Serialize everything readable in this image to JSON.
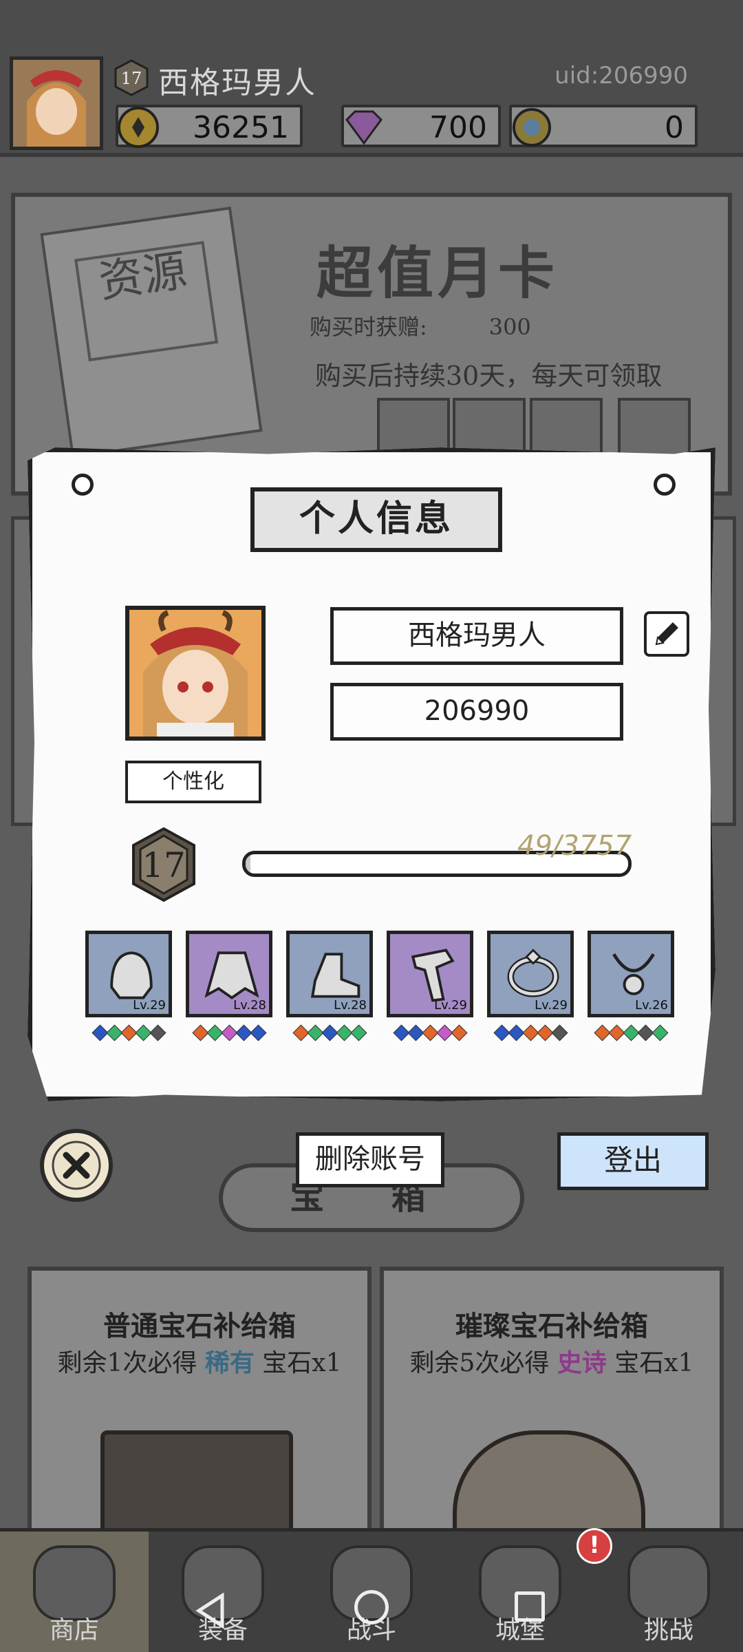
{
  "header": {
    "level": "17",
    "player_name": "西格玛男人",
    "uid_label": "uid:206990",
    "resources": [
      {
        "icon": "gold-coin-icon",
        "value": "36251"
      },
      {
        "icon": "purple-gem-icon",
        "value": "700"
      },
      {
        "icon": "blue-orb-coin-icon",
        "value": "0"
      }
    ]
  },
  "background_shop": {
    "paper_stamp": "资源",
    "monthly_card_title": "超值月卡",
    "bonus_label": "购买时获赠:",
    "bonus_amount": "300",
    "duration_text": "购买后持续30天，每天可领取",
    "resource_peek": "300",
    "gem_tab": "宝 箱",
    "chests": [
      {
        "title": "普通宝石补给箱",
        "desc_prefix": "剩余1次必得",
        "rarity": "稀有",
        "desc_suffix": "宝石x1"
      },
      {
        "title": "璀璨宝石补给箱",
        "desc_prefix": "剩余5次必得",
        "rarity": "史诗",
        "desc_suffix": "宝石x1"
      }
    ]
  },
  "bottom_nav": {
    "items": [
      {
        "label": "商店",
        "active": true
      },
      {
        "label": "装备",
        "active": false
      },
      {
        "label": "战斗",
        "active": false
      },
      {
        "label": "城堡",
        "active": false
      },
      {
        "label": "挑战",
        "active": false
      }
    ],
    "notification_badge": "!"
  },
  "modal": {
    "title": "个人信息",
    "name_value": "西格玛男人",
    "id_value": "206990",
    "customize_label": "个性化",
    "level": "17",
    "xp_text": "49/3757",
    "xp_fraction": 0.013,
    "equipment": [
      {
        "icon": "helmet-icon",
        "level": "Lv.29",
        "rarity": "blue",
        "gems": [
          "#2b57c4",
          "#39b36a",
          "#e0662b",
          "#39b36a",
          "#555555"
        ]
      },
      {
        "icon": "cape-icon",
        "level": "Lv.28",
        "rarity": "purple",
        "gems": [
          "#e0662b",
          "#39b36a",
          "#c45bc6",
          "#2b57c4",
          "#2b57c4"
        ]
      },
      {
        "icon": "boots-icon",
        "level": "Lv.28",
        "rarity": "blue",
        "gems": [
          "#e0662b",
          "#39b36a",
          "#2b57c4",
          "#39b36a",
          "#39b36a"
        ]
      },
      {
        "icon": "bracer-icon",
        "level": "Lv.29",
        "rarity": "purple",
        "gems": [
          "#2b57c4",
          "#2b57c4",
          "#e0662b",
          "#c45bc6",
          "#e0662b"
        ]
      },
      {
        "icon": "ring-icon",
        "level": "Lv.29",
        "rarity": "blue",
        "gems": [
          "#2b57c4",
          "#2b57c4",
          "#e0662b",
          "#e0662b",
          "#555555"
        ]
      },
      {
        "icon": "necklace-icon",
        "level": "Lv.26",
        "rarity": "blue",
        "gems": [
          "#e0662b",
          "#e0662b",
          "#39b36a",
          "#555555",
          "#39b36a"
        ]
      }
    ],
    "delete_account_label": "删除账号",
    "logout_label": "登出"
  }
}
